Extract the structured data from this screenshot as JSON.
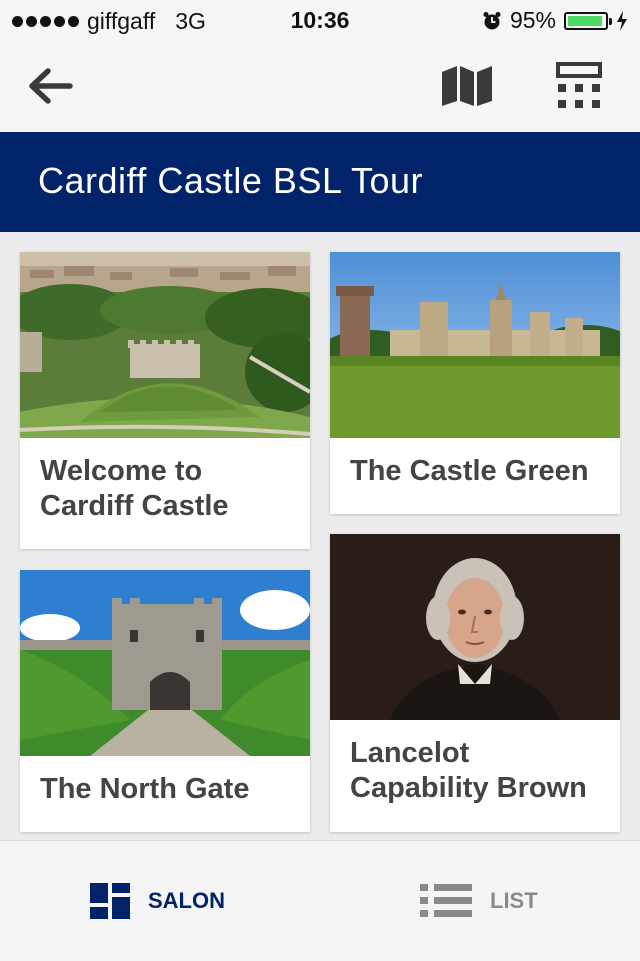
{
  "status_bar": {
    "carrier": "giffgaff",
    "network": "3G",
    "time": "10:36",
    "battery_percent": "95%",
    "battery_level": 0.95,
    "battery_color": "#4cd964"
  },
  "toolbar": {
    "back_icon": "arrow-left-icon",
    "map_icon": "map-icon",
    "keypad_icon": "keypad-icon"
  },
  "header": {
    "title": "Cardiff Castle BSL Tour",
    "background_color": "#00236a"
  },
  "cards": [
    {
      "title": "Welcome to Cardiff Castle",
      "image": "castle-keep-aerial"
    },
    {
      "title": "The Castle Green",
      "image": "castle-green-lawn"
    },
    {
      "title": "The North Gate",
      "image": "north-gate"
    },
    {
      "title": "Lancelot Capability Brown",
      "image": "portrait-capability-brown"
    }
  ],
  "tab_bar": {
    "tabs": [
      {
        "label": "SALON",
        "icon": "grid-icon",
        "active": true
      },
      {
        "label": "LIST",
        "icon": "list-icon",
        "active": false
      }
    ],
    "active_color": "#00236a",
    "inactive_color": "#8a8a8a"
  }
}
